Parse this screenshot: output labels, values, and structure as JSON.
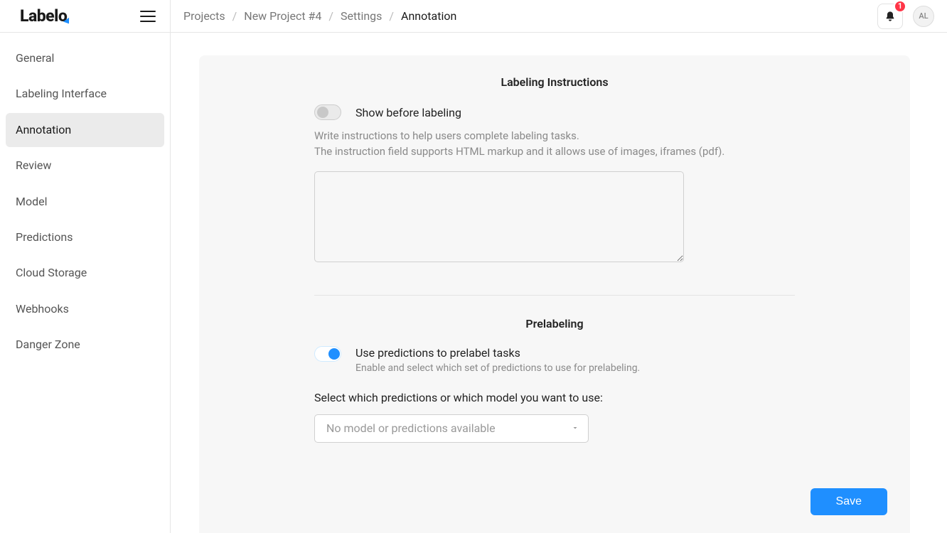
{
  "logo": "Labelo",
  "sidebar": {
    "items": [
      {
        "label": "General"
      },
      {
        "label": "Labeling Interface"
      },
      {
        "label": "Annotation"
      },
      {
        "label": "Review"
      },
      {
        "label": "Model"
      },
      {
        "label": "Predictions"
      },
      {
        "label": "Cloud Storage"
      },
      {
        "label": "Webhooks"
      },
      {
        "label": "Danger Zone"
      }
    ],
    "active_index": 2
  },
  "breadcrumbs": [
    "Projects",
    "New Project #4",
    "Settings",
    "Annotation"
  ],
  "notifications": {
    "count": "1"
  },
  "user_initials": "AL",
  "sections": {
    "labeling_instructions": {
      "title": "Labeling Instructions",
      "toggle_label": "Show before labeling",
      "toggle_on": false,
      "help_line1": "Write instructions to help users complete labeling tasks.",
      "help_line2": "The instruction field supports HTML markup and it allows use of images, iframes (pdf).",
      "textarea_value": ""
    },
    "prelabeling": {
      "title": "Prelabeling",
      "toggle_label": "Use predictions to prelabel tasks",
      "toggle_sub": "Enable and select which set of predictions to use for prelabeling.",
      "toggle_on": true,
      "field_label": "Select which predictions or which model you want to use:",
      "select_placeholder": "No model or predictions available"
    }
  },
  "actions": {
    "save": "Save"
  }
}
